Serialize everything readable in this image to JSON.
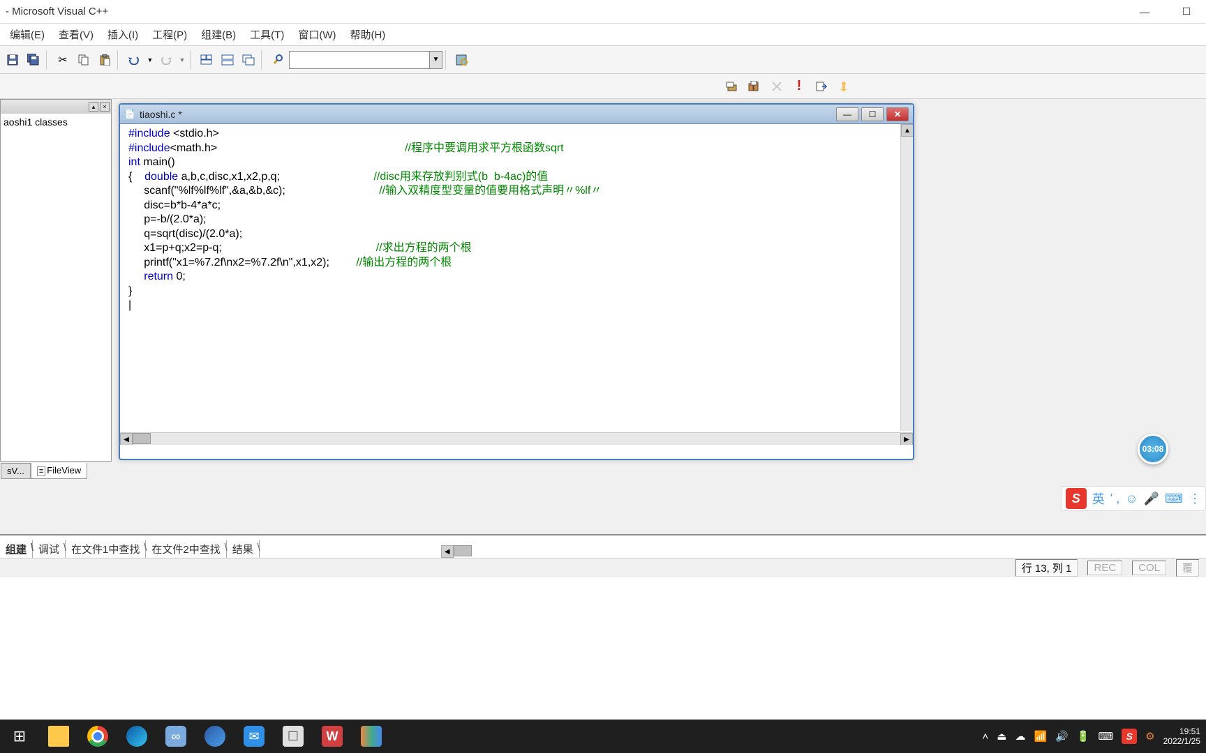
{
  "titlebar": {
    "text": " - Microsoft Visual C++"
  },
  "menu": {
    "edit": "编辑(E)",
    "view": "查看(V)",
    "insert": "插入(I)",
    "project": "工程(P)",
    "build": "组建(B)",
    "tools": "工具(T)",
    "window": "窗口(W)",
    "help": "帮助(H)"
  },
  "left_panel": {
    "tree_root": "aoshi1 classes",
    "tab1": "sV...",
    "tab2": "FileView"
  },
  "editor": {
    "title": "tiaoshi.c *",
    "code": {
      "l1a": "#include",
      "l1b": " <stdio.h>",
      "l2a": "#include",
      "l2b": "<math.h>",
      "l2c": "//程序中要调用求平方根函数sqrt",
      "l3a": "int",
      "l3b": " main()",
      "l4a": "{    ",
      "l4b": "double",
      "l4c": " a,b,c,disc,x1,x2,p,q;",
      "l4d": "//disc用来存放判别式(b  b-4ac)的值",
      "l5": "     scanf(\"%lf%lf%lf\",&a,&b,&c);",
      "l5c": "//输入双精度型变量的值要用格式声明〃%lf〃",
      "l6": "     disc=b*b-4*a*c;",
      "l7": "     p=-b/(2.0*a);",
      "l8": "     q=sqrt(disc)/(2.0*a);",
      "l9": "     x1=p+q;x2=p-q;",
      "l9c": "//求出方程的两个根",
      "l10": "     printf(\"x1=%7.2f\\nx2=%7.2f\\n\",x1,x2);",
      "l10c": "//输出方程的两个根",
      "l11a": "     ",
      "l11b": "return",
      "l11c": " 0;",
      "l12": "}",
      "l13": "|"
    }
  },
  "timer": "03:08",
  "ime": {
    "lang": "英",
    "dot": "' ,"
  },
  "output_tabs": {
    "t1": "组建",
    "t2": "调试",
    "t3": "在文件1中查找",
    "t4": "在文件2中查找",
    "t5": "结果"
  },
  "status": {
    "pos": "行 13, 列 1",
    "rec": "REC",
    "col": "COL",
    "ovr": "覆"
  },
  "taskbar": {
    "time": "19:51",
    "date": "2022/1/25"
  }
}
